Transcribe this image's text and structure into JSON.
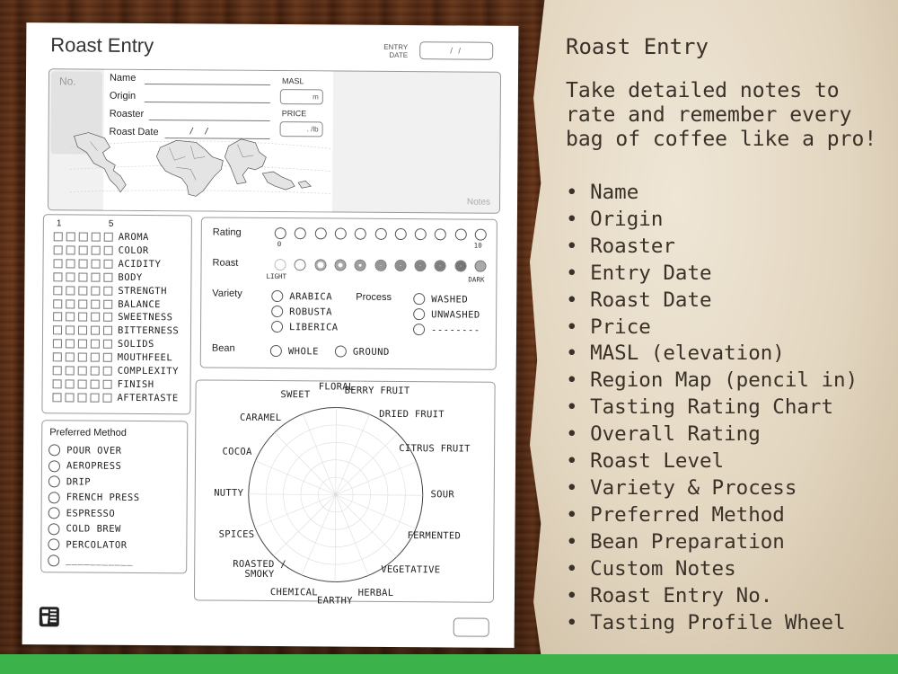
{
  "sheet": {
    "title": "Roast Entry",
    "entry_date_label_1": "ENTRY",
    "entry_date_label_2": "DATE",
    "entry_date_placeholder": "/   /",
    "no_label": "No.",
    "fields": {
      "name": "Name",
      "origin": "Origin",
      "roaster": "Roaster",
      "roast_date": "Roast Date",
      "roast_date_placeholder": "/   /"
    },
    "masl_label": "MASL",
    "masl_unit": "m",
    "price_label": "PRICE",
    "price_unit": ".   /lb",
    "notes_label": "Notes",
    "rating_scale": {
      "low": "1",
      "high": "5",
      "attributes": [
        "AROMA",
        "COLOR",
        "ACIDITY",
        "BODY",
        "STRENGTH",
        "BALANCE",
        "SWEETNESS",
        "BITTERNESS",
        "SOLIDS",
        "MOUTHFEEL",
        "COMPLEXITY",
        "FINISH",
        "AFTERTASTE"
      ]
    },
    "preferred_method": {
      "title": "Preferred Method",
      "options": [
        "POUR OVER",
        "AEROPRESS",
        "DRIP",
        "FRENCH PRESS",
        "ESPRESSO",
        "COLD BREW",
        "PERCOLATOR",
        "___________"
      ]
    },
    "rating": {
      "label": "Rating",
      "min": "0",
      "max": "10"
    },
    "roast": {
      "label": "Roast",
      "light": "LIGHT",
      "dark": "DARK"
    },
    "variety": {
      "label": "Variety",
      "options": [
        "ARABICA",
        "ROBUSTA",
        "LIBERICA"
      ]
    },
    "process": {
      "label": "Process",
      "options": [
        "WASHED",
        "UNWASHED",
        "--------"
      ]
    },
    "bean": {
      "label": "Bean",
      "options": [
        "WHOLE",
        "GROUND"
      ]
    },
    "wheel": {
      "labels": [
        "FLORAL",
        "BERRY FRUIT",
        "DRIED FRUIT",
        "CITRUS FRUIT",
        "SOUR",
        "FERMENTED",
        "VEGETATIVE",
        "HERBAL",
        "EARTHY",
        "CHEMICAL",
        "ROASTED / SMOKY",
        "SPICES",
        "NUTTY",
        "COCOA",
        "CARAMEL",
        "SWEET"
      ]
    }
  },
  "panel": {
    "title": "Roast Entry",
    "description": "Take detailed notes to rate and remember every bag of coffee like a pro!",
    "features": [
      "Name",
      "Origin",
      "Roaster",
      "Entry Date",
      "Roast Date",
      "Price",
      "MASL (elevation)",
      "Region Map (pencil in)",
      "Tasting Rating Chart",
      "Overall Rating",
      "Roast Level",
      "Variety & Process",
      "Preferred Method",
      "Bean Preparation",
      "Custom Notes",
      "Roast Entry No.",
      "Tasting Profile Wheel"
    ]
  }
}
